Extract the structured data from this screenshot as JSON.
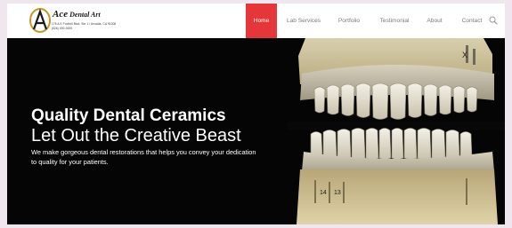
{
  "brand": {
    "name": "Ace",
    "name_suffix": "Dental Art",
    "address_line": "175 A E Foothill Blvd, Ste 1 / Arcadia, CA 91006",
    "phone_line": "(626) 000-0000"
  },
  "nav": {
    "items": [
      {
        "label": "Home",
        "active": true
      },
      {
        "label": "Lab Services",
        "active": false
      },
      {
        "label": "Portfolio",
        "active": false
      },
      {
        "label": "Testimonial",
        "active": false
      },
      {
        "label": "About",
        "active": false
      },
      {
        "label": "Contact",
        "active": false
      }
    ],
    "search_icon": "search-icon"
  },
  "hero": {
    "title": "Quality Dental Ceramics",
    "subtitle": "Let Out the Creative Beast",
    "text": "We make gorgeous dental restorations that helps you convey your dedication to quality for your patients.",
    "image_labels": [
      "X",
      "14",
      "13"
    ]
  },
  "colors": {
    "accent": "#e5363a",
    "hero_bg": "#050505",
    "page_bg": "#efe6ee",
    "logo_gold": "#c8962e"
  }
}
